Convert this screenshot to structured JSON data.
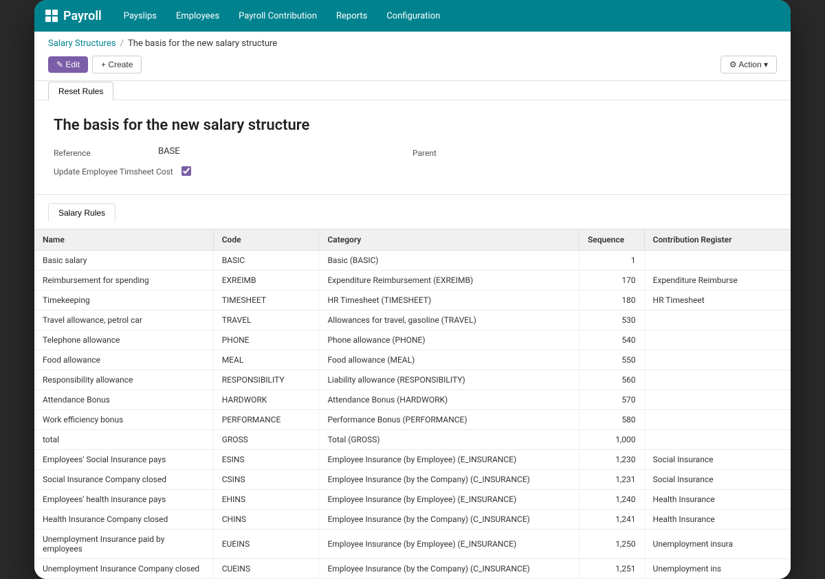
{
  "app": {
    "logo": "Payroll",
    "nav": [
      {
        "label": "Payslips",
        "id": "payslips"
      },
      {
        "label": "Employees",
        "id": "employees"
      },
      {
        "label": "Payroll Contribution",
        "id": "payroll-contribution"
      },
      {
        "label": "Reports",
        "id": "reports"
      },
      {
        "label": "Configuration",
        "id": "configuration"
      }
    ]
  },
  "breadcrumb": {
    "parent": "Salary Structures",
    "separator": "/",
    "current": "The basis for the new salary structure"
  },
  "toolbar": {
    "edit_label": "✎ Edit",
    "create_label": "+ Create",
    "action_label": "⚙ Action ▾",
    "reset_rules_label": "Reset Rules"
  },
  "form": {
    "title": "The basis for the new salary structure",
    "fields": {
      "reference_label": "Reference",
      "reference_value": "BASE",
      "parent_label": "Parent",
      "update_timesheet_label": "Update Employee Timsheet Cost",
      "update_timesheet_checked": true
    }
  },
  "tabs": {
    "salary_rules_label": "Salary Rules"
  },
  "table": {
    "columns": [
      {
        "label": "Name",
        "id": "name"
      },
      {
        "label": "Code",
        "id": "code"
      },
      {
        "label": "Category",
        "id": "category"
      },
      {
        "label": "Sequence",
        "id": "sequence"
      },
      {
        "label": "Contribution Register",
        "id": "contribution_register"
      }
    ],
    "rows": [
      {
        "name": "Basic salary",
        "code": "BASIC",
        "category": "Basic (BASIC)",
        "sequence": "1",
        "contribution": ""
      },
      {
        "name": "Reimbursement for spending",
        "code": "EXREIMB",
        "category": "Expenditure Reimbursement (EXREIMB)",
        "sequence": "170",
        "contribution": "Expenditure Reimburse"
      },
      {
        "name": "Timekeeping",
        "code": "TIMESHEET",
        "category": "HR Timesheet (TIMESHEET)",
        "sequence": "180",
        "contribution": "HR Timesheet"
      },
      {
        "name": "Travel allowance, petrol car",
        "code": "TRAVEL",
        "category": "Allowances for travel, gasoline (TRAVEL)",
        "sequence": "530",
        "contribution": ""
      },
      {
        "name": "Telephone allowance",
        "code": "PHONE",
        "category": "Phone allowance (PHONE)",
        "sequence": "540",
        "contribution": ""
      },
      {
        "name": "Food allowance",
        "code": "MEAL",
        "category": "Food allowance (MEAL)",
        "sequence": "550",
        "contribution": ""
      },
      {
        "name": "Responsibility allowance",
        "code": "RESPONSIBILITY",
        "category": "Liability allowance (RESPONSIBILITY)",
        "sequence": "560",
        "contribution": ""
      },
      {
        "name": "Attendance Bonus",
        "code": "HARDWORK",
        "category": "Attendance Bonus (HARDWORK)",
        "sequence": "570",
        "contribution": ""
      },
      {
        "name": "Work efficiency bonus",
        "code": "PERFORMANCE",
        "category": "Performance Bonus (PERFORMANCE)",
        "sequence": "580",
        "contribution": ""
      },
      {
        "name": "total",
        "code": "GROSS",
        "category": "Total (GROSS)",
        "sequence": "1,000",
        "contribution": ""
      },
      {
        "name": "Employees' Social Insurance pays",
        "code": "ESINS",
        "category": "Employee Insurance (by Employee) (E_INSURANCE)",
        "sequence": "1,230",
        "contribution": "Social Insurance"
      },
      {
        "name": "Social Insurance Company closed",
        "code": "CSINS",
        "category": "Employee Insurance (by the Company) (C_INSURANCE)",
        "sequence": "1,231",
        "contribution": "Social Insurance"
      },
      {
        "name": "Employees' health insurance pays",
        "code": "EHINS",
        "category": "Employee Insurance (by Employee) (E_INSURANCE)",
        "sequence": "1,240",
        "contribution": "Health Insurance"
      },
      {
        "name": "Health Insurance Company closed",
        "code": "CHINS",
        "category": "Employee Insurance (by the Company) (C_INSURANCE)",
        "sequence": "1,241",
        "contribution": "Health Insurance"
      },
      {
        "name": "Unemployment Insurance paid by employees",
        "code": "EUEINS",
        "category": "Employee Insurance (by Employee) (E_INSURANCE)",
        "sequence": "1,250",
        "contribution": "Unemployment insura"
      },
      {
        "name": "Unemployment Insurance Company closed",
        "code": "CUEINS",
        "category": "Employee Insurance (by the Company) (C_INSURANCE)",
        "sequence": "1,251",
        "contribution": "Unemployment ins"
      }
    ]
  }
}
